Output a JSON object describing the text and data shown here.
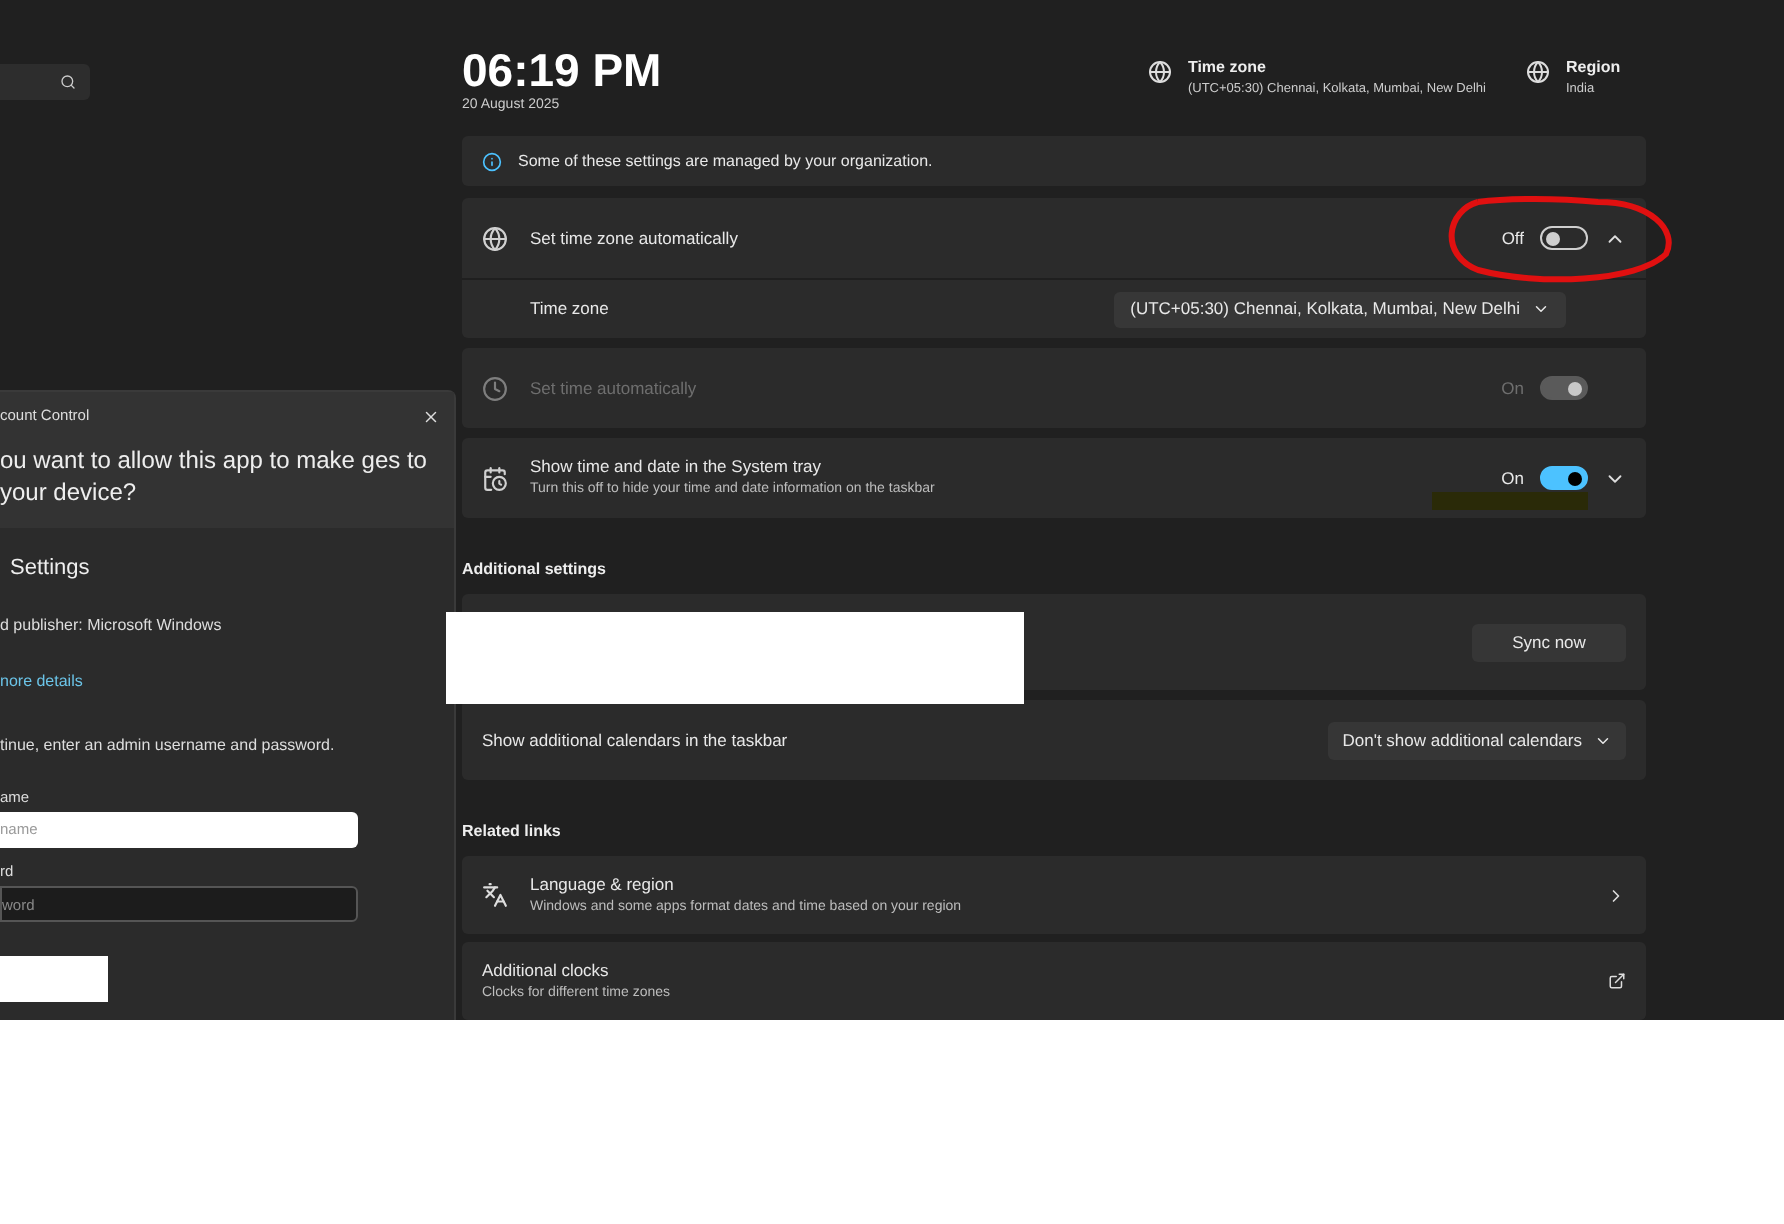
{
  "uac_dialog": {
    "title": "count Control",
    "question": "ou want to allow this app to make ges to your device?",
    "app_name": "Settings",
    "publisher": "d publisher: Microsoft Windows",
    "details_link": "nore details",
    "instruction": "tinue, enter an admin username and password.",
    "fields": [
      {
        "label": "ame",
        "placeholder": "name",
        "focused": true
      },
      {
        "label": "rd",
        "placeholder": "word",
        "focused": false
      }
    ]
  },
  "header": {
    "time": "06:19 PM",
    "date": "20 August 2025",
    "time_zone": {
      "label": "Time zone",
      "value": "(UTC+05:30) Chennai, Kolkata, Mumbai, New Delhi"
    },
    "region": {
      "label": "Region",
      "value": "India"
    }
  },
  "notice": "Some of these settings are managed by your organization.",
  "settings": [
    {
      "title": "Set time zone automatically",
      "state_label": "Off",
      "on": false,
      "disabled": false,
      "expanded": true,
      "annotated": true,
      "children": [
        {
          "title": "Time zone",
          "value": "(UTC+05:30) Chennai, Kolkata, Mumbai, New Delhi"
        }
      ]
    },
    {
      "title": "Set time automatically",
      "state_label": "On",
      "on": true,
      "disabled": true
    },
    {
      "title": "Show time and date in the System tray",
      "subtitle": "Turn this off to hide your time and date information on the taskbar",
      "state_label": "On",
      "on": true,
      "disabled": false,
      "expanded": false,
      "annotated": false
    }
  ],
  "additional_settings": {
    "heading": "Additional settings",
    "rows": [
      {
        "kind": "button",
        "button": "Sync now"
      },
      {
        "kind": "select",
        "title": "Show additional calendars in the taskbar",
        "value": "Don't show additional calendars"
      }
    ]
  },
  "related_links": {
    "heading": "Related links",
    "items": [
      {
        "kind": "page",
        "title": "Language & region",
        "subtitle": "Windows and some apps format dates and time based on your region"
      },
      {
        "kind": "external",
        "title": "Additional clocks",
        "subtitle": "Clocks for different time zones"
      }
    ]
  }
}
